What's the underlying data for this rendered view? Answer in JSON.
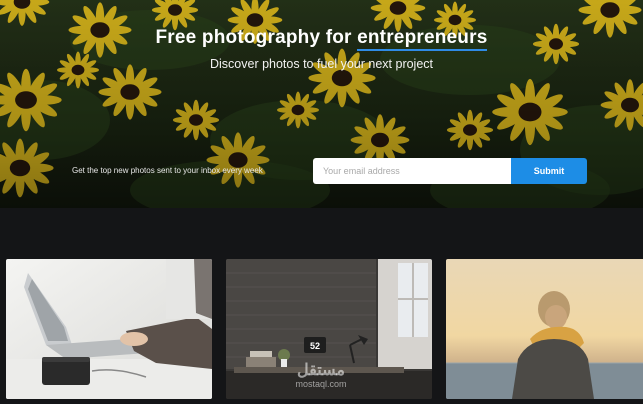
{
  "hero": {
    "title_prefix": "Free photography for ",
    "title_accent": "entrepreneurs",
    "subtitle": "Discover photos to fuel your next project",
    "background_image": "yellow-flowers-photo"
  },
  "newsletter": {
    "label": "Get the top new photos sent to your inbox every week",
    "email_placeholder": "Your email address",
    "submit_label": "Submit"
  },
  "gallery": {
    "photos": [
      {
        "subject": "laptop-and-speaker-photo"
      },
      {
        "subject": "desk-with-clock-photo",
        "clock_text": "52"
      },
      {
        "subject": "person-at-sunset-photo"
      }
    ]
  },
  "watermark": {
    "glyph": "مستقل",
    "text": "mostaql.com"
  },
  "colors": {
    "accent": "#1d8de6",
    "page_background": "#141517",
    "flower_petal": "#f2cc1f"
  }
}
